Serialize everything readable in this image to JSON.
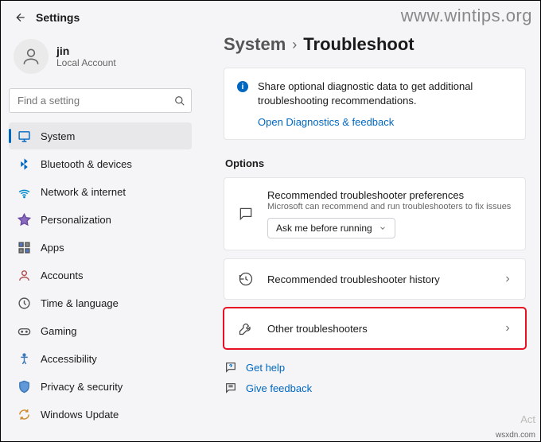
{
  "app": {
    "title": "Settings"
  },
  "watermark": "www.wintips.org",
  "source": "wsxdn.com",
  "activation": "Act",
  "user": {
    "name": "jin",
    "account_type": "Local Account"
  },
  "search": {
    "placeholder": "Find a setting"
  },
  "sidebar": {
    "items": [
      {
        "label": "System"
      },
      {
        "label": "Bluetooth & devices"
      },
      {
        "label": "Network & internet"
      },
      {
        "label": "Personalization"
      },
      {
        "label": "Apps"
      },
      {
        "label": "Accounts"
      },
      {
        "label": "Time & language"
      },
      {
        "label": "Gaming"
      },
      {
        "label": "Accessibility"
      },
      {
        "label": "Privacy & security"
      },
      {
        "label": "Windows Update"
      }
    ]
  },
  "breadcrumb": {
    "parent": "System",
    "current": "Troubleshoot"
  },
  "info_card": {
    "text": "Share optional diagnostic data to get additional troubleshooting recommendations.",
    "link": "Open Diagnostics & feedback"
  },
  "options": {
    "heading": "Options",
    "prefs": {
      "title": "Recommended troubleshooter preferences",
      "subtitle": "Microsoft can recommend and run troubleshooters to fix issues",
      "dropdown": "Ask me before running"
    },
    "history": {
      "title": "Recommended troubleshooter history"
    },
    "other": {
      "title": "Other troubleshooters"
    }
  },
  "footer": {
    "help": "Get help",
    "feedback": "Give feedback"
  }
}
